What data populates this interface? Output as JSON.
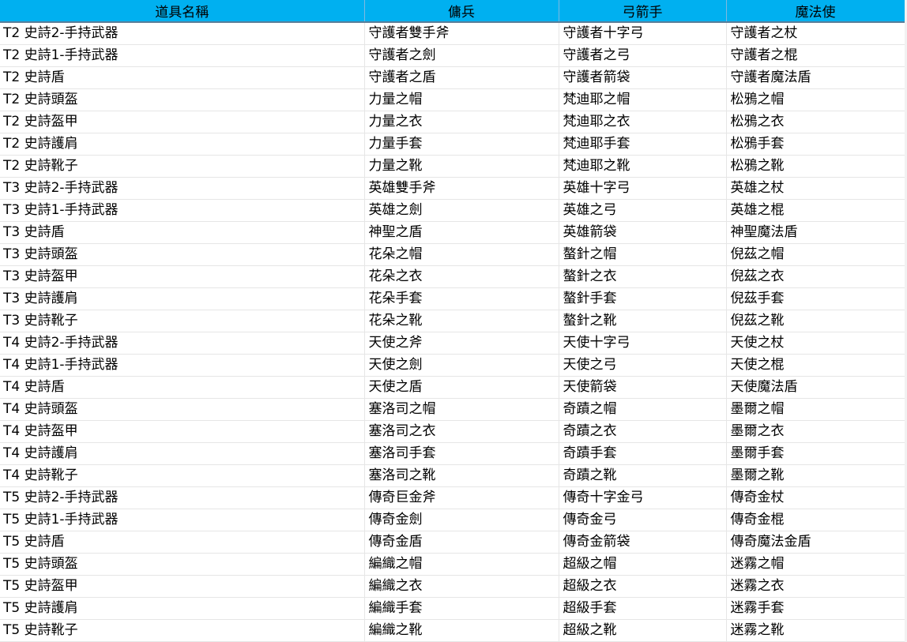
{
  "headers": [
    "道具名稱",
    "傭兵",
    "弓箭手",
    "魔法使"
  ],
  "rows": [
    [
      "T2 史詩2-手持武器",
      "守護者雙手斧",
      "守護者十字弓",
      "守護者之杖"
    ],
    [
      "T2 史詩1-手持武器",
      "守護者之劍",
      "守護者之弓",
      "守護者之棍"
    ],
    [
      "T2 史詩盾",
      "守護者之盾",
      "守護者箭袋",
      "守護者魔法盾"
    ],
    [
      "T2 史詩頭盔",
      "力量之帽",
      "梵迪耶之帽",
      "松鴉之帽"
    ],
    [
      "T2 史詩盔甲",
      "力量之衣",
      "梵迪耶之衣",
      "松鴉之衣"
    ],
    [
      "T2 史詩護肩",
      "力量手套",
      "梵迪耶手套",
      "松鴉手套"
    ],
    [
      "T2 史詩靴子",
      "力量之靴",
      "梵迪耶之靴",
      "松鴉之靴"
    ],
    [
      "T3 史詩2-手持武器",
      "英雄雙手斧",
      "英雄十字弓",
      "英雄之杖"
    ],
    [
      "T3 史詩1-手持武器",
      "英雄之劍",
      "英雄之弓",
      "英雄之棍"
    ],
    [
      "T3 史詩盾",
      "神聖之盾",
      "英雄箭袋",
      "神聖魔法盾"
    ],
    [
      "T3 史詩頭盔",
      "花朵之帽",
      "螯針之帽",
      "倪茲之帽"
    ],
    [
      "T3 史詩盔甲",
      "花朵之衣",
      "螯針之衣",
      "倪茲之衣"
    ],
    [
      "T3 史詩護肩",
      "花朵手套",
      "螯針手套",
      "倪茲手套"
    ],
    [
      "T3 史詩靴子",
      "花朵之靴",
      "螯針之靴",
      "倪茲之靴"
    ],
    [
      "T4 史詩2-手持武器",
      "天使之斧",
      "天使十字弓",
      "天使之杖"
    ],
    [
      "T4 史詩1-手持武器",
      "天使之劍",
      "天使之弓",
      "天使之棍"
    ],
    [
      "T4 史詩盾",
      "天使之盾",
      "天使箭袋",
      "天使魔法盾"
    ],
    [
      "T4 史詩頭盔",
      "塞洛司之帽",
      "奇蹟之帽",
      "墨爾之帽"
    ],
    [
      "T4 史詩盔甲",
      "塞洛司之衣",
      "奇蹟之衣",
      "墨爾之衣"
    ],
    [
      "T4 史詩護肩",
      "塞洛司手套",
      "奇蹟手套",
      "墨爾手套"
    ],
    [
      "T4 史詩靴子",
      "塞洛司之靴",
      "奇蹟之靴",
      "墨爾之靴"
    ],
    [
      "T5 史詩2-手持武器",
      "傳奇巨金斧",
      "傳奇十字金弓",
      "傳奇金杖"
    ],
    [
      "T5 史詩1-手持武器",
      "傳奇金劍",
      "傳奇金弓",
      "傳奇金棍"
    ],
    [
      "T5 史詩盾",
      "傳奇金盾",
      "傳奇金箭袋",
      "傳奇魔法金盾"
    ],
    [
      "T5 史詩頭盔",
      "編織之帽",
      "超級之帽",
      "迷霧之帽"
    ],
    [
      "T5 史詩盔甲",
      "編織之衣",
      "超級之衣",
      "迷霧之衣"
    ],
    [
      "T5 史詩護肩",
      "編織手套",
      "超級手套",
      "迷霧手套"
    ],
    [
      "T5 史詩靴子",
      "編織之靴",
      "超級之靴",
      "迷霧之靴"
    ]
  ]
}
